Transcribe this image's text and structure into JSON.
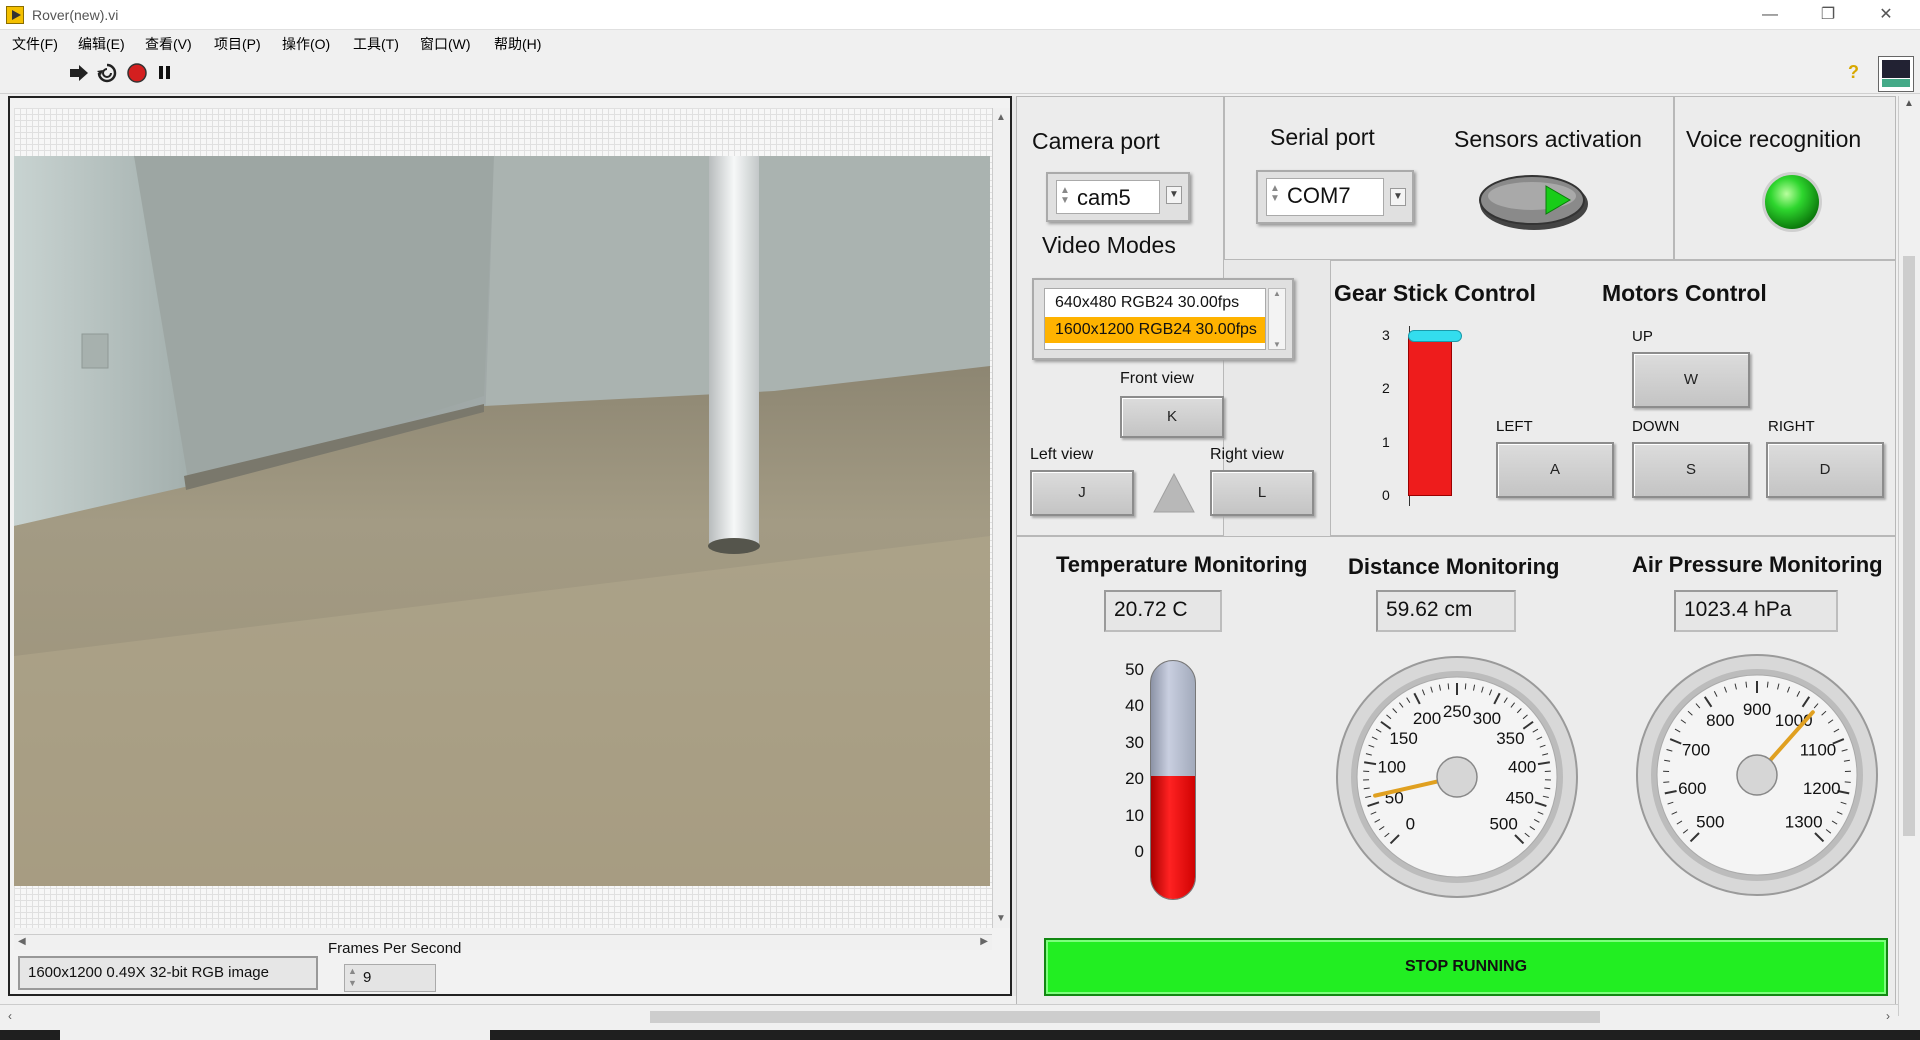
{
  "window": {
    "title": "Rover(new).vi",
    "controls": [
      "—",
      "❐",
      "✕"
    ]
  },
  "menu": [
    "文件(F)",
    "编辑(E)",
    "查看(V)",
    "项目(P)",
    "操作(O)",
    "工具(T)",
    "窗口(W)",
    "帮助(H)"
  ],
  "toolbar": {
    "help": "?"
  },
  "image_display": {
    "info": "1600x1200 0.49X 32-bit RGB image",
    "fps_label": "Frames Per Second",
    "fps_value": "9"
  },
  "camera": {
    "label": "Camera port",
    "value": "cam5",
    "video_modes_label": "Video Modes",
    "modes": [
      "640x480 RGB24 30.00fps",
      "1600x1200 RGB24 30.00fps"
    ],
    "selected_mode_index": 1,
    "selected_color": "#ffb300"
  },
  "serial": {
    "label": "Serial port",
    "value": "COM7"
  },
  "sensors": {
    "label": "Sensors activation",
    "state": "on"
  },
  "voice": {
    "label": "Voice recognition",
    "led_color": "#22cc22"
  },
  "views": {
    "front_label": "Front view",
    "front_key": "K",
    "left_label": "Left view",
    "left_key": "J",
    "right_label": "Right view",
    "right_key": "L"
  },
  "gear": {
    "title": "Gear Stick Control",
    "ticks": [
      "3",
      "2",
      "1",
      "0"
    ],
    "value": 3,
    "max": 3,
    "fill_color": "#ee1c1c",
    "slider_color": "#33ddee"
  },
  "motors": {
    "title": "Motors Control",
    "up_label": "UP",
    "up_key": "W",
    "left_label": "LEFT",
    "left_key": "A",
    "down_label": "DOWN",
    "down_key": "S",
    "right_label": "RIGHT",
    "right_key": "D"
  },
  "temperature": {
    "title": "Temperature Monitoring",
    "readout": "20.72 C",
    "value": 20.72,
    "ticks": [
      "50",
      "40",
      "30",
      "20",
      "10",
      "0"
    ],
    "min": 0,
    "max": 50
  },
  "distance": {
    "title": "Distance Monitoring",
    "readout": "59.62 cm",
    "value": 59.62,
    "min": 0,
    "max": 500,
    "ticks": [
      "0",
      "50",
      "100",
      "150",
      "200",
      "250",
      "300",
      "350",
      "400",
      "450",
      "500"
    ]
  },
  "pressure": {
    "title": "Air Pressure Monitoring",
    "readout": "1023.4 hPa",
    "value": 1023.4,
    "min": 500,
    "max": 1300,
    "ticks": [
      "500",
      "600",
      "700",
      "800",
      "900",
      "1000",
      "1100",
      "1200",
      "1300"
    ]
  },
  "stop_button": "STOP RUNNING",
  "colors": {
    "stop_green": "#22ee22",
    "needle": "#e0a020"
  }
}
